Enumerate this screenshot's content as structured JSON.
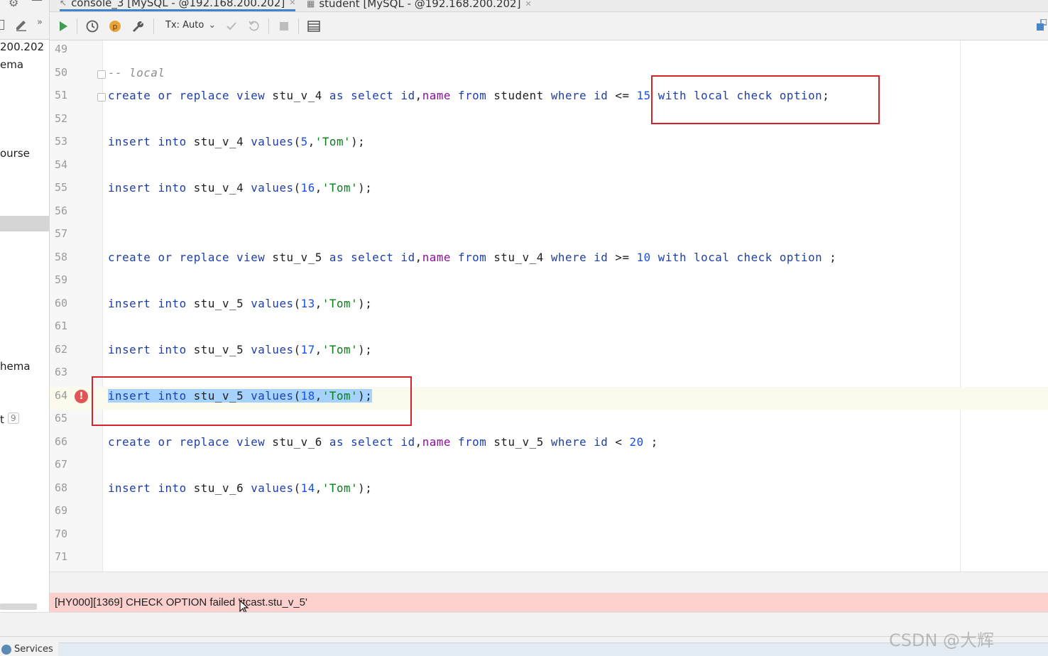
{
  "tabs": [
    {
      "label": "console_3 [MySQL - @192.168.200.202]",
      "icon": "console-icon",
      "active": true
    },
    {
      "label": "student [MySQL - @192.168.200.202]",
      "icon": "table-icon",
      "active": false
    }
  ],
  "toolbar": {
    "tx_label": "Tx: Auto",
    "icons": [
      "execute-icon",
      "history-icon",
      "profile-icon",
      "settings-wrench-icon",
      "commit-check-icon",
      "rollback-icon",
      "stop-icon",
      "output-layout-icon"
    ]
  },
  "sidebar": {
    "items": [
      "200.202",
      "ema",
      "ourse",
      "hema",
      "t"
    ],
    "badge": "9"
  },
  "editor": {
    "lines": [
      {
        "n": "49",
        "code": ""
      },
      {
        "n": "50",
        "code": "-- local"
      },
      {
        "n": "51",
        "code": "create or replace view stu_v_4 as select id,name from student where id <= 15 with local check option;"
      },
      {
        "n": "52",
        "code": ""
      },
      {
        "n": "53",
        "code": "insert into stu_v_4 values(5,'Tom');"
      },
      {
        "n": "54",
        "code": ""
      },
      {
        "n": "55",
        "code": "insert into stu_v_4 values(16,'Tom');"
      },
      {
        "n": "56",
        "code": ""
      },
      {
        "n": "57",
        "code": ""
      },
      {
        "n": "58",
        "code": "create or replace view stu_v_5 as select id,name from stu_v_4 where id >= 10 with local check option ;"
      },
      {
        "n": "59",
        "code": ""
      },
      {
        "n": "60",
        "code": "insert into stu_v_5 values(13,'Tom');"
      },
      {
        "n": "61",
        "code": ""
      },
      {
        "n": "62",
        "code": "insert into stu_v_5 values(17,'Tom');"
      },
      {
        "n": "63",
        "code": ""
      },
      {
        "n": "64",
        "code": "insert into stu_v_5 values(18,'Tom');"
      },
      {
        "n": "65",
        "code": ""
      },
      {
        "n": "66",
        "code": "create or replace view stu_v_6 as select id,name from stu_v_5 where id < 20 ;"
      },
      {
        "n": "67",
        "code": ""
      },
      {
        "n": "68",
        "code": "insert into stu_v_6 values(14,'Tom');"
      },
      {
        "n": "69",
        "code": ""
      },
      {
        "n": "70",
        "code": ""
      },
      {
        "n": "71",
        "code": ""
      }
    ],
    "error_line": "64",
    "error_icon": "error-exclamation-icon"
  },
  "error_message": "[HY000][1369] CHECK OPTION failed 'itcast.stu_v_5'",
  "statusbar": {
    "services_label": "Services"
  },
  "watermark": "CSDN @大辉",
  "colors": {
    "keyword": "#1d3ea8",
    "string": "#067d17",
    "number": "#1750eb",
    "column": "#871094",
    "error_bar": "#fbd0cd",
    "annotation_box": "#d6232a",
    "selection": "#a6d2ff"
  }
}
